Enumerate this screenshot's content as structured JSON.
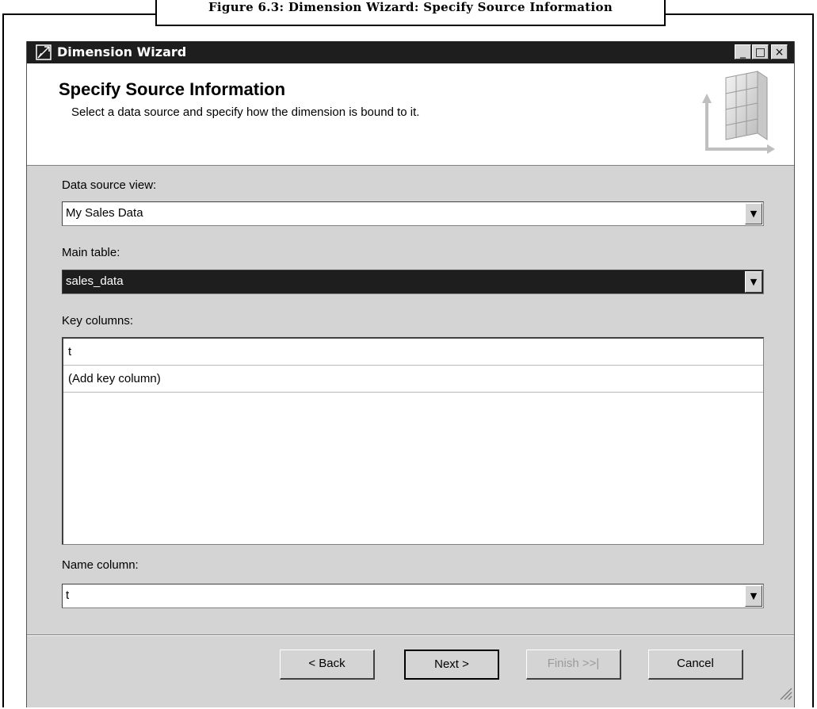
{
  "figure": {
    "caption": "Figure 6.3: Dimension Wizard: Specify Source Information"
  },
  "window": {
    "title": "Dimension Wizard",
    "title_icon": "wizard-icon",
    "controls": {
      "minimize": "_",
      "maximize": "□",
      "close": "×"
    }
  },
  "header": {
    "title": "Specify Source Information",
    "subtitle": "Select a data source and specify how the dimension is bound to it.",
    "graphic_icon": "cube-grid-icon"
  },
  "form": {
    "data_source_view": {
      "label": "Data source view:",
      "value": "My Sales Data"
    },
    "main_table": {
      "label": "Main table:",
      "value": "sales_data"
    },
    "key_columns": {
      "label": "Key columns:",
      "rows": [
        "t",
        "(Add key column)"
      ]
    },
    "name_column": {
      "label": "Name column:",
      "value": "t"
    }
  },
  "buttons": {
    "back": "< Back",
    "next": "Next >",
    "finish": "Finish >>|",
    "cancel": "Cancel"
  },
  "colors": {
    "titlebar": "#1e1e1e",
    "dialog_bg": "#d4d4d4",
    "selection": "#1e1e1e"
  }
}
